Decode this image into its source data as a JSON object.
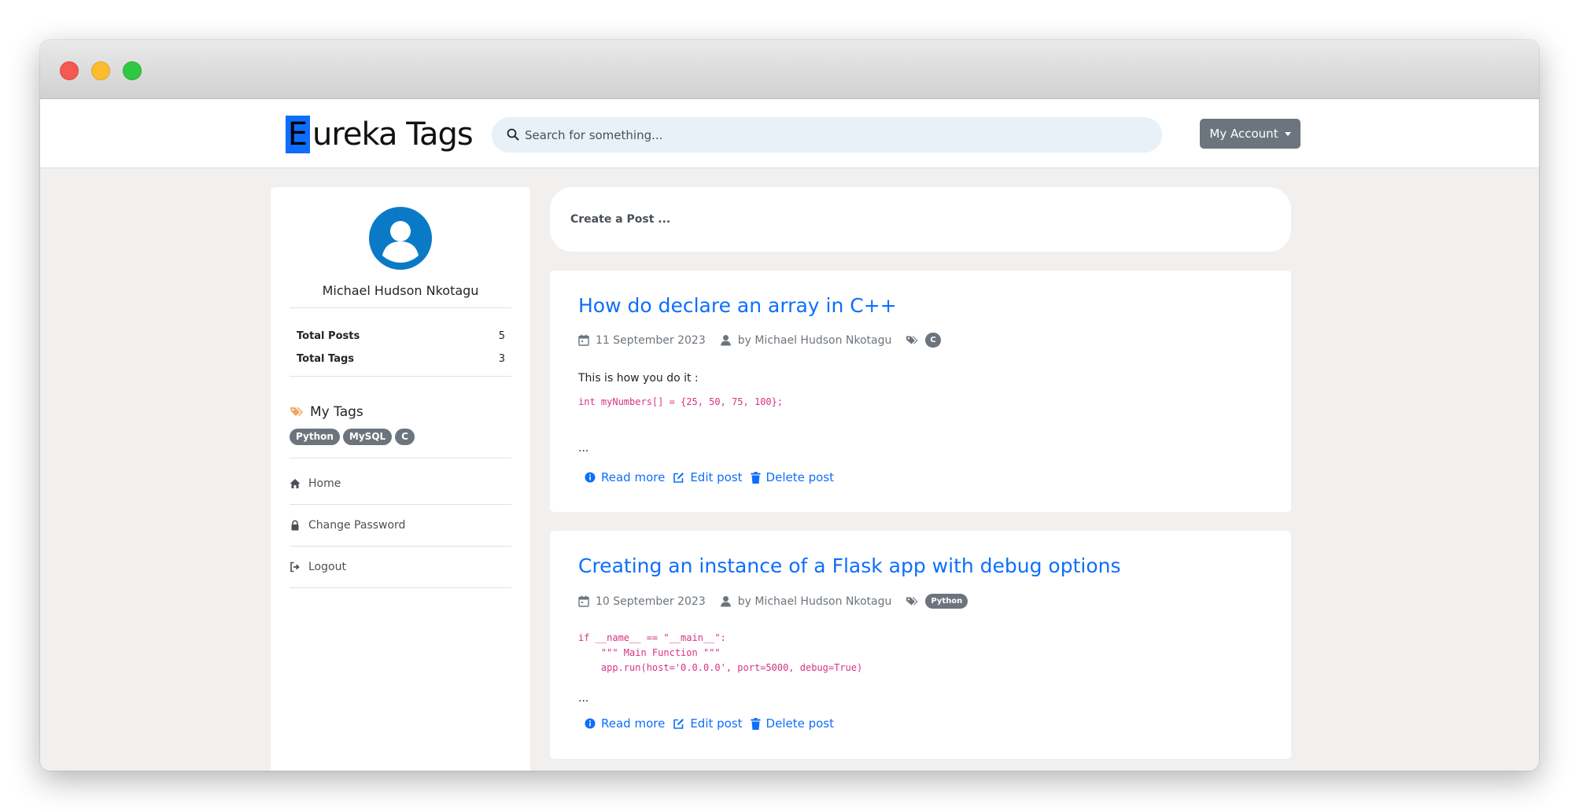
{
  "app": {
    "logo_initial": "E",
    "logo_rest": "ureka Tags",
    "search_placeholder": "Search for something...",
    "account_label": "My Account"
  },
  "profile": {
    "name": "Michael Hudson Nkotagu",
    "stats": [
      {
        "label": "Total Posts",
        "value": "5"
      },
      {
        "label": "Total Tags",
        "value": "3"
      }
    ],
    "tags_title": "My Tags",
    "tags": [
      "Python",
      "MySQL",
      "C"
    ]
  },
  "sidebar_nav": [
    {
      "label": "Home",
      "icon": "home-icon"
    },
    {
      "label": "Change Password",
      "icon": "lock-icon"
    },
    {
      "label": "Logout",
      "icon": "logout-icon"
    }
  ],
  "create_post_label": "Create a Post ...",
  "posts": [
    {
      "title": "How do declare an array in C++",
      "date": "11 September 2023",
      "author": "by Michael Hudson Nkotagu",
      "tag": "C",
      "text": "This is how you do it :",
      "code": "int myNumbers[] = {25, 50, 75, 100};",
      "ellipsis": "...",
      "actions": {
        "read": "Read more",
        "edit": "Edit post",
        "delete": "Delete post"
      }
    },
    {
      "title": "Creating an instance of a Flask app with debug options",
      "date": "10 September 2023",
      "author": "by Michael Hudson Nkotagu",
      "tag": "Python",
      "code": "if __name__ == \"__main__\":\n    \"\"\" Main Function \"\"\"\n    app.run(host='0.0.0.0', port=5000, debug=True)",
      "ellipsis": "...",
      "actions": {
        "read": "Read more",
        "edit": "Edit post",
        "delete": "Delete post"
      }
    }
  ],
  "colors": {
    "primary": "#0d6efd",
    "secondary": "#6c757d",
    "code": "#d63384",
    "avatar": "#0a7ac7",
    "tag_icon": "#f0a35e"
  }
}
